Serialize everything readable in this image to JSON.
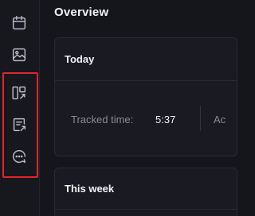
{
  "sidebar": {
    "items": [
      {
        "icon": "calendar-icon"
      },
      {
        "icon": "image-icon"
      },
      {
        "icon": "dashboard-link-icon"
      },
      {
        "icon": "report-link-icon"
      },
      {
        "icon": "chat-link-icon"
      }
    ],
    "highlight_color": "#e3242b"
  },
  "page": {
    "title": "Overview"
  },
  "today": {
    "title": "Today",
    "tracked_label": "Tracked time:",
    "tracked_value": "5:37",
    "next_label": "Ac"
  },
  "week": {
    "title": "This week"
  }
}
